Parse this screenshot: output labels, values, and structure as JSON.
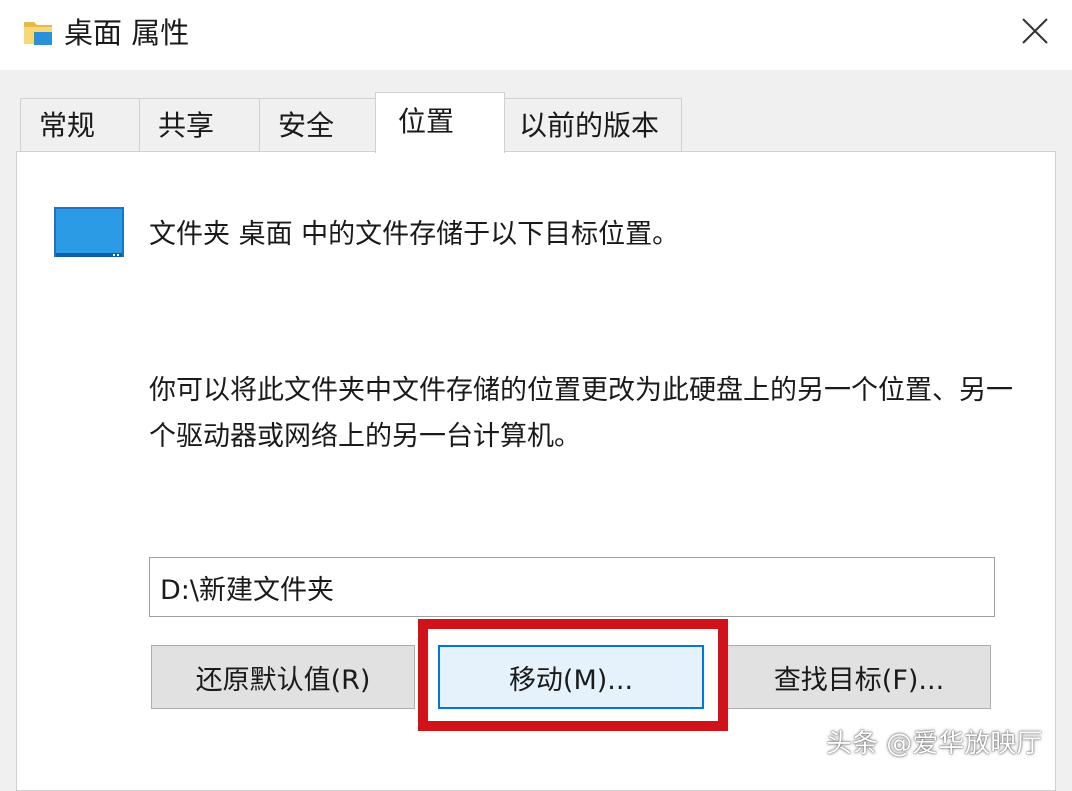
{
  "window": {
    "title": "桌面 属性",
    "icon": "folder-icon",
    "close_icon": "close-icon"
  },
  "tabs": [
    {
      "label": "常规",
      "active": false
    },
    {
      "label": "共享",
      "active": false
    },
    {
      "label": "安全",
      "active": false
    },
    {
      "label": "位置",
      "active": true
    },
    {
      "label": "以前的版本",
      "active": false
    }
  ],
  "location": {
    "icon": "desktop-icon",
    "intro": "文件夹 桌面 中的文件存储于以下目标位置。",
    "description": "你可以将此文件夹中文件存储的位置更改为此硬盘上的另一个位置、另一个驱动器或网络上的另一台计算机。",
    "path_value": "D:\\新建文件夹"
  },
  "buttons": {
    "restore": "还原默认值(R)",
    "move": "移动(M)...",
    "find_target": "查找目标(F)..."
  },
  "annotation": {
    "highlight_color": "#d0121b"
  },
  "watermark": "头条 @爱华放映厅",
  "colors": {
    "accent": "#0078d7",
    "folder_yellow": "#f8d775",
    "desktop_blue": "#2b9be6"
  }
}
